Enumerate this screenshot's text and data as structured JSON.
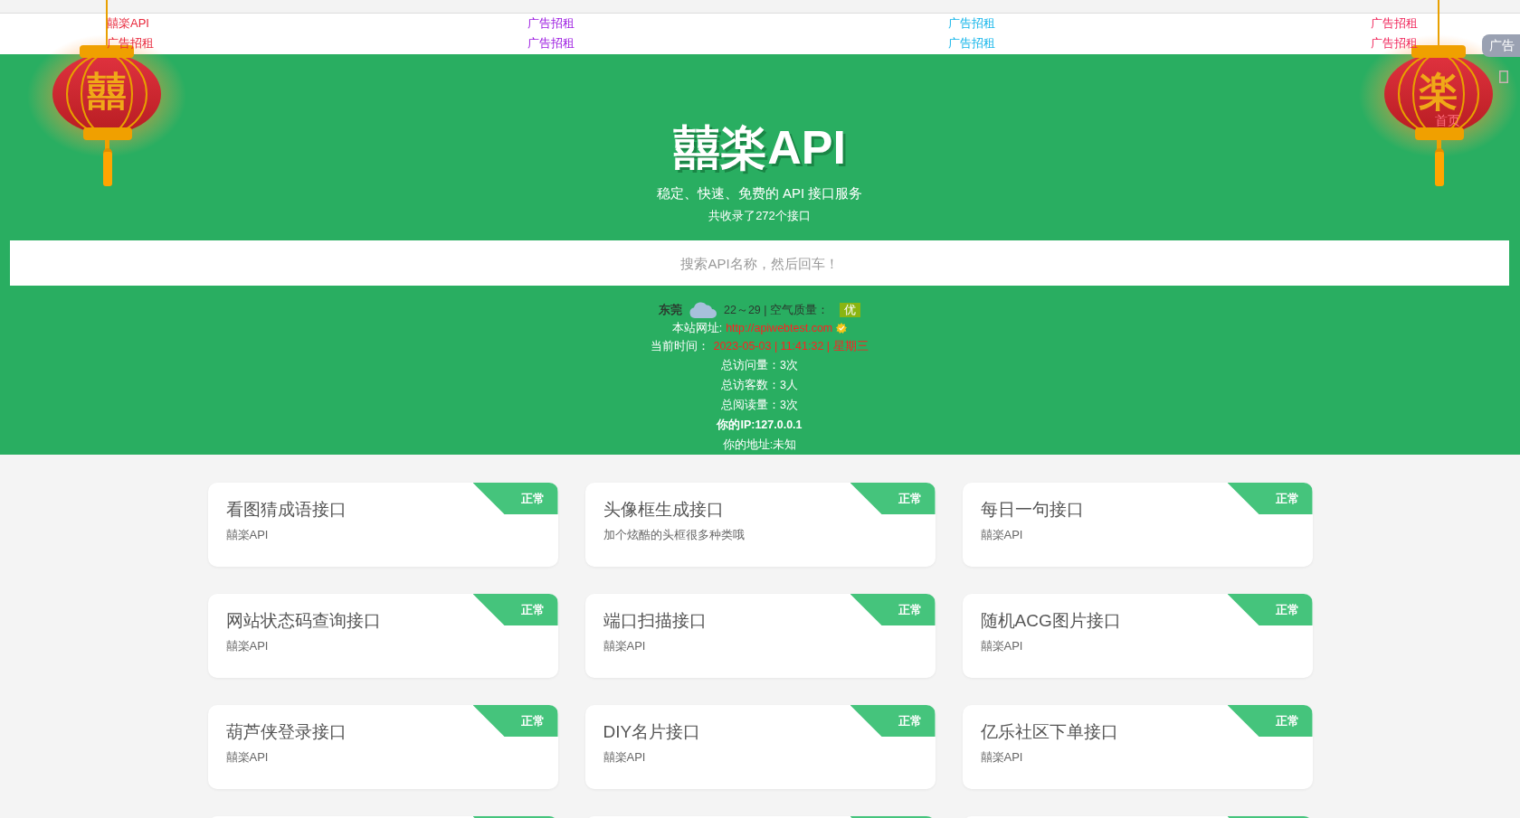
{
  "ad_bar": {
    "columns": [
      {
        "color": "#e8263a",
        "items": [
          "囍楽API",
          "广告招租"
        ]
      },
      {
        "color": "#9b19e0",
        "items": [
          "广告招租",
          "广告招租"
        ]
      },
      {
        "color": "#13b5ea",
        "items": [
          "广告招租",
          "广告招租"
        ]
      },
      {
        "color": "#f0255a",
        "items": [
          "广告招租",
          "广告招租"
        ]
      }
    ]
  },
  "side_tab": {
    "label": "广告"
  },
  "lanterns": [
    {
      "character": "囍"
    },
    {
      "character": "楽",
      "link": "首页"
    }
  ],
  "hero": {
    "title": "囍楽API",
    "subtitle": "稳定、快速、免费的 API 接口服务",
    "count_text": "共收录了272个接口"
  },
  "search": {
    "placeholder": "搜索API名称，然后回车！"
  },
  "info": {
    "city": "东莞",
    "temperature": "22～29 | 空气质量：",
    "air_quality": "优",
    "site_label": "本站网址:",
    "site_url": "http://apiwebtest.com",
    "time_label": "当前时间：",
    "time_value": "2023-05-03 | 11:41:32 | 星期三",
    "stats": [
      {
        "text": "总访问量：3次",
        "bold": false
      },
      {
        "text": "总访客数：3人",
        "bold": false
      },
      {
        "text": "总阅读量：3次",
        "bold": false
      },
      {
        "text": "你的IP:127.0.0.1",
        "bold": true
      },
      {
        "text": "你的地址:未知",
        "bold": false
      }
    ]
  },
  "cards": [
    {
      "kind": "full",
      "title": "看图猜成语接口",
      "description": "囍楽API",
      "status": "正常"
    },
    {
      "kind": "full",
      "title": "头像框生成接口",
      "description": "加个炫酷的头框很多种类哦",
      "status": "正常"
    },
    {
      "kind": "full",
      "title": "每日一句接口",
      "description": "囍楽API",
      "status": "正常"
    },
    {
      "kind": "full",
      "title": "网站状态码查询接口",
      "description": "囍楽API",
      "status": "正常"
    },
    {
      "kind": "full",
      "title": "端口扫描接口",
      "description": "囍楽API",
      "status": "正常"
    },
    {
      "kind": "full",
      "title": "随机ACG图片接口",
      "description": "囍楽API",
      "status": "正常"
    },
    {
      "kind": "full",
      "title": "葫芦侠登录接口",
      "description": "囍楽API",
      "status": "正常"
    },
    {
      "kind": "full",
      "title": "DIY名片接口",
      "description": "囍楽API",
      "status": "正常"
    },
    {
      "kind": "full",
      "title": "亿乐社区下单接口",
      "description": "囍楽API",
      "status": "正常"
    },
    {
      "kind": "partial"
    },
    {
      "kind": "partial"
    },
    {
      "kind": "partial"
    }
  ]
}
